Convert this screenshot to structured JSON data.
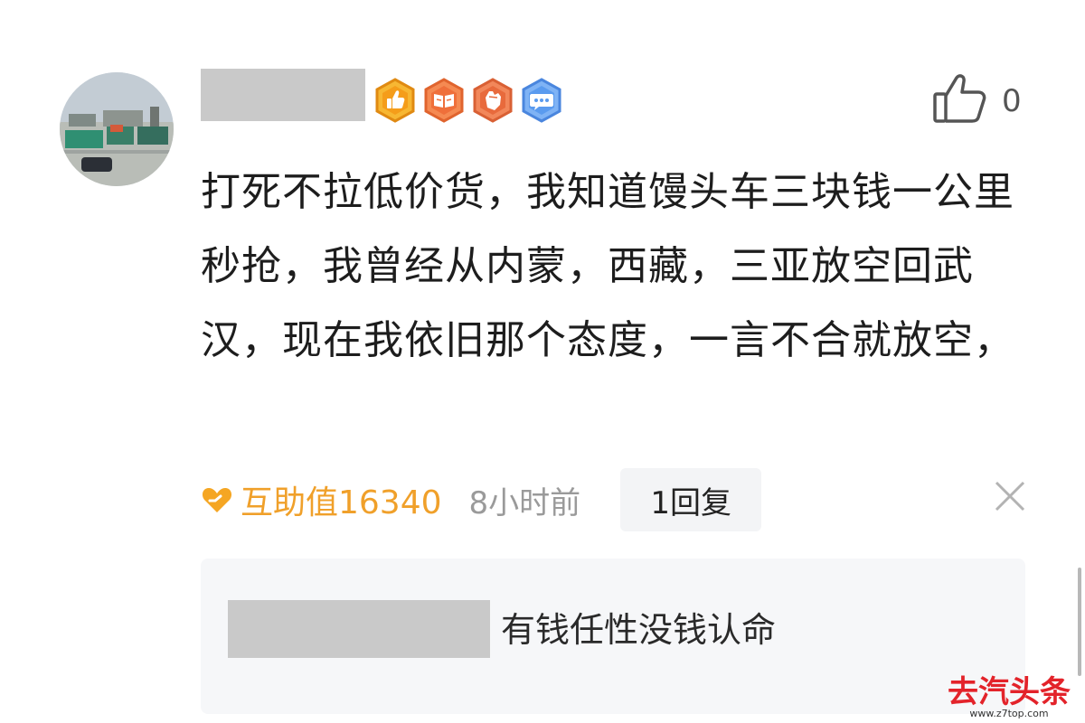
{
  "comment": {
    "like_count": "0",
    "text": "打死不拉低价货，我知道馒头车三块钱一公里秒抢，我曾经从内蒙，西藏，三亚放空回武汉，现在我依旧那个态度，一言不合就放空，",
    "helpful_label": "互助值16340",
    "time": "8小时前",
    "reply_button": "1回复",
    "badges": [
      "thumbs-up-badge-icon",
      "book-badge-icon",
      "fist-badge-icon",
      "chat-badge-icon"
    ]
  },
  "reply": {
    "text": "有钱任性没钱认命"
  },
  "watermark": {
    "logo": "去汽头条",
    "url": "www.z7top.com"
  },
  "colors": {
    "accent_orange": "#f0a02a",
    "watermark_red": "#e3232a",
    "time_gray": "#9a9a9a",
    "reply_bg": "#f6f7f9"
  }
}
